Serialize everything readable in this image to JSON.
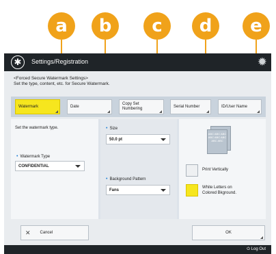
{
  "callouts": [
    "a",
    "b",
    "c",
    "d",
    "e"
  ],
  "window": {
    "title": "Settings/Registration",
    "app_icon": "settings-icon",
    "corner_icon": "gear-icon"
  },
  "description": "<Forced Secure Watermark Settings>\nSet the type, content, etc. for Secure Watermark.",
  "tabs": [
    {
      "label": "Watermark",
      "active": true
    },
    {
      "label": "Date",
      "active": false
    },
    {
      "label": "Copy Set\nNumbering",
      "active": false
    },
    {
      "label": "Serial Number",
      "active": false
    },
    {
      "label": "ID/User Name",
      "active": false
    }
  ],
  "panel": {
    "instruction": "Set the watermark type.",
    "watermark_type": {
      "label": "Watermark Type",
      "value": "CONFIDENTIAL"
    },
    "size": {
      "label": "Size",
      "value": "50.0 pt"
    },
    "background_pattern": {
      "label": "Background Pattern",
      "value": "Fans"
    },
    "preview_text": "ABC ABC ABC ABC ABC ABC ABC ABC",
    "print_vertically": {
      "label": "Print Vertically",
      "checked": false
    },
    "white_letters": {
      "label": "White Letters on\nColored Bkground.",
      "checked": true
    }
  },
  "footer": {
    "cancel_label": "Cancel",
    "ok_label": "OK"
  },
  "status": {
    "logout_label": "Log Out"
  },
  "colors": {
    "accent_yellow": "#f6e61e",
    "callout_orange": "#f0a21a",
    "titlebar": "#1f2428"
  }
}
